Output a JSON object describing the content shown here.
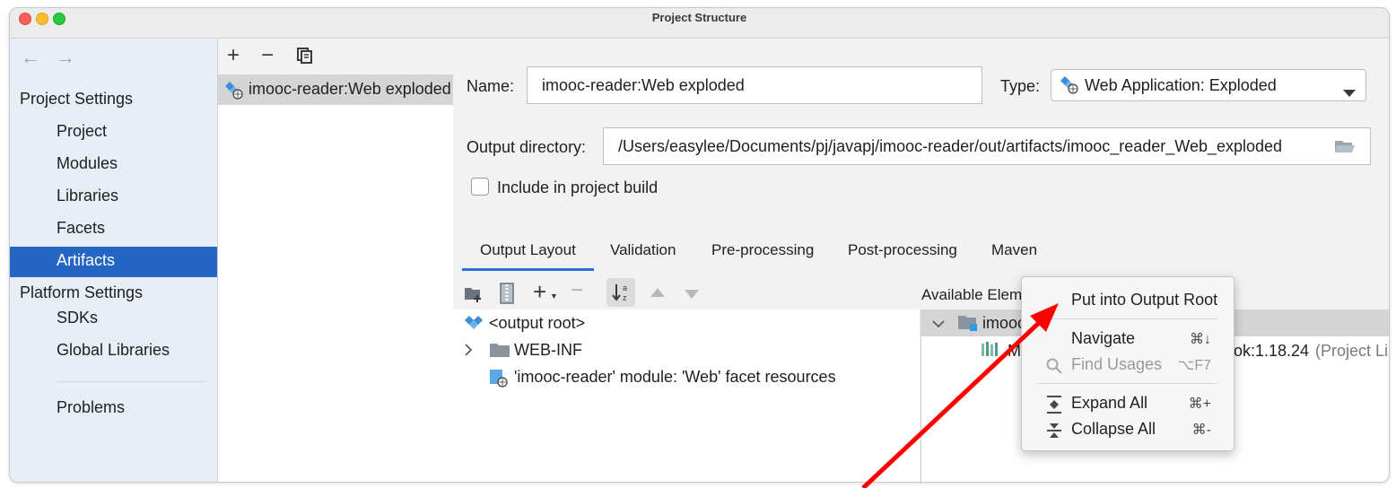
{
  "window": {
    "title": "Project Structure"
  },
  "colors": {
    "accent": "#2666c3",
    "arrow": "#ff0000",
    "tab_underline": "#2f6fd3"
  },
  "nav": {
    "back": "←",
    "forward": "→"
  },
  "sidebar": {
    "project_settings_header": "Project Settings",
    "project_items": [
      "Project",
      "Modules",
      "Libraries",
      "Facets",
      "Artifacts"
    ],
    "selected": "Artifacts",
    "platform_settings_header": "Platform Settings",
    "platform_items": [
      "SDKs",
      "Global Libraries"
    ],
    "problems": "Problems"
  },
  "artifacts": {
    "toolbar": {
      "add": "+",
      "remove": "−",
      "copy": "copy-icon"
    },
    "selected_item": "imooc-reader:Web exploded"
  },
  "form": {
    "name_label": "Name:",
    "name_value": "imooc-reader:Web exploded",
    "type_label": "Type:",
    "type_value": "Web Application: Exploded",
    "output_label": "Output directory:",
    "output_value": "/Users/easylee/Documents/pj/javapj/imooc-reader/out/artifacts/imooc_reader_Web_exploded",
    "include_label": "Include in project build",
    "include_checked": false
  },
  "tabs": [
    "Output Layout",
    "Validation",
    "Pre-processing",
    "Post-processing",
    "Maven"
  ],
  "active_tab": "Output Layout",
  "layout_tree": {
    "root": "<output root>",
    "webinf": "WEB-INF",
    "facet": "'imooc-reader' module: 'Web' facet resources"
  },
  "available": {
    "title": "Available Elements",
    "help": "?",
    "module_visible": "imooc-",
    "lib_prefix": "Ma",
    "lib_suffix": "ok:1.18.24",
    "lib_note": "(Project Li"
  },
  "context_menu": {
    "put_into_root": "Put into Output Root",
    "navigate": "Navigate",
    "navigate_key": "⌘↓",
    "find_usages": "Find Usages",
    "find_usages_key": "⌥F7",
    "expand_all": "Expand All",
    "expand_all_key": "⌘+",
    "collapse_all": "Collapse All",
    "collapse_all_key": "⌘-"
  }
}
